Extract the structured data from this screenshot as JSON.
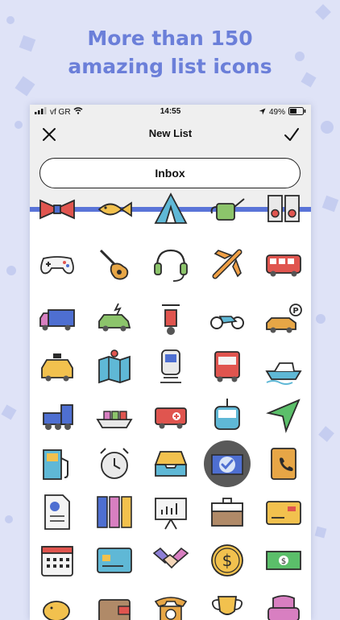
{
  "headline": {
    "line1": "More than 150",
    "line2": "amazing list icons"
  },
  "status_bar": {
    "carrier": "vf GR",
    "time": "14:55",
    "battery": "49%"
  },
  "nav": {
    "title": "New List"
  },
  "list_name_field": {
    "value": "Inbox"
  },
  "colors": {
    "accent": "#5a74d8",
    "headline": "#6b7fd9",
    "background": "#dfe3f7"
  },
  "icon_grid": {
    "selected": "inbox-tray-icon",
    "rows": [
      [
        "bowtie-icon",
        "fish-icon",
        "tent-icon",
        "watering-can-icon",
        "speakers-icon"
      ],
      [
        "gamepad-icon",
        "guitar-icon",
        "headset-icon",
        "airplane-icon",
        "bus-icon"
      ],
      [
        "truck-icon",
        "car-icon",
        "scooter-icon",
        "motorcycle-icon",
        "parking-car-icon"
      ],
      [
        "taxi-icon",
        "map-icon",
        "train-icon",
        "lorry-icon",
        "ship-icon"
      ],
      [
        "locomotive-icon",
        "cargo-ship-icon",
        "ambulance-icon",
        "cable-car-icon",
        "navigation-arrow-icon"
      ],
      [
        "fuel-pump-icon",
        "alarm-clock-icon",
        "inbox-tray-icon",
        "selected-check-icon",
        "address-book-icon"
      ],
      [
        "document-chart-icon",
        "binders-icon",
        "presentation-icon",
        "briefcase-icon",
        "credit-card-icon"
      ],
      [
        "calendar-icon",
        "card-icon",
        "handshake-icon",
        "dollar-coin-icon",
        "banknote-icon"
      ],
      [
        "piggy-bank-icon",
        "wallet-icon",
        "telephone-icon",
        "trophy-icon",
        "armchair-icon"
      ]
    ]
  }
}
